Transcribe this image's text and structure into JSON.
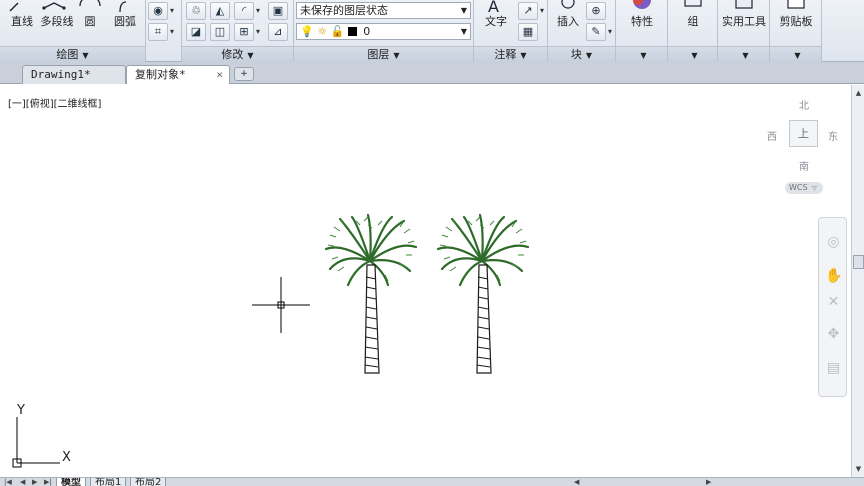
{
  "ribbon": {
    "draw": {
      "line_label": "直线",
      "polyline_label": "多段线",
      "circle_label": "圆",
      "arc_label": "圆弧",
      "panel_title": "绘图"
    },
    "modify": {
      "panel_title": "修改"
    },
    "layers": {
      "state_value": "未保存的图层状态",
      "layer_value": "0",
      "layer_color": "#000000",
      "panel_title": "图层"
    },
    "annotation": {
      "text_label": "文字",
      "panel_title": "注释"
    },
    "block": {
      "insert_label": "插入",
      "panel_title": "块"
    },
    "properties_label": "特性",
    "group_label": "组",
    "utilities_label": "实用工具",
    "clipboard_label": "剪贴板"
  },
  "tabs": [
    {
      "label": "Drawing1*"
    },
    {
      "label": "复制对象*"
    }
  ],
  "viewport": {
    "label": "[一][俯视][二维线框]"
  },
  "viewcube": {
    "north": "北",
    "south": "南",
    "east": "东",
    "west": "西",
    "face": "上",
    "wcs": "WCS"
  },
  "ucs": {
    "x": "X",
    "y": "Y"
  },
  "layout_tabs": [
    {
      "label": "模型"
    },
    {
      "label": "布局1"
    },
    {
      "label": "布局2"
    }
  ],
  "colors": {
    "palm_foliage": "#2e6b2b",
    "trunk": "#1a1a1a",
    "ribbon_bg": "#e6ebf2"
  }
}
